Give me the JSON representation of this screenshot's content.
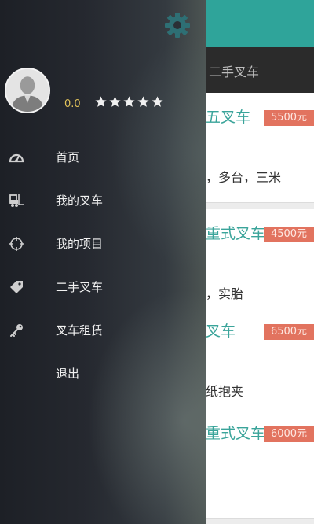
{
  "background": {
    "tab_label": "二手叉车",
    "cards": [
      {
        "title": "五叉车",
        "price": "5500元",
        "desc": "，多台，三米"
      },
      {
        "title": "重式叉车",
        "price": "4500元",
        "desc": "，实胎"
      },
      {
        "title": "叉车",
        "price": "6500元",
        "desc": "纸抱夹"
      },
      {
        "title": "重式叉车",
        "price": "6000元",
        "desc": ""
      }
    ]
  },
  "drawer": {
    "settings_icon": "gear-icon",
    "user": {
      "avatar_icon": "avatar-person-icon",
      "score": "0.0",
      "rating": 5
    },
    "menu": [
      {
        "label": "首页",
        "icon": "speedometer-icon"
      },
      {
        "label": "我的叉车",
        "icon": "forklift-icon"
      },
      {
        "label": "我的项目",
        "icon": "crosshair-icon"
      },
      {
        "label": "二手叉车",
        "icon": "tag-icon"
      },
      {
        "label": "叉车租赁",
        "icon": "key-icon"
      },
      {
        "label": "退出",
        "icon": ""
      }
    ]
  },
  "colors": {
    "header": "#2fa49a",
    "price_badge": "#e2735f",
    "score_text": "#e0c15a",
    "accent_title": "#3aa49a"
  }
}
